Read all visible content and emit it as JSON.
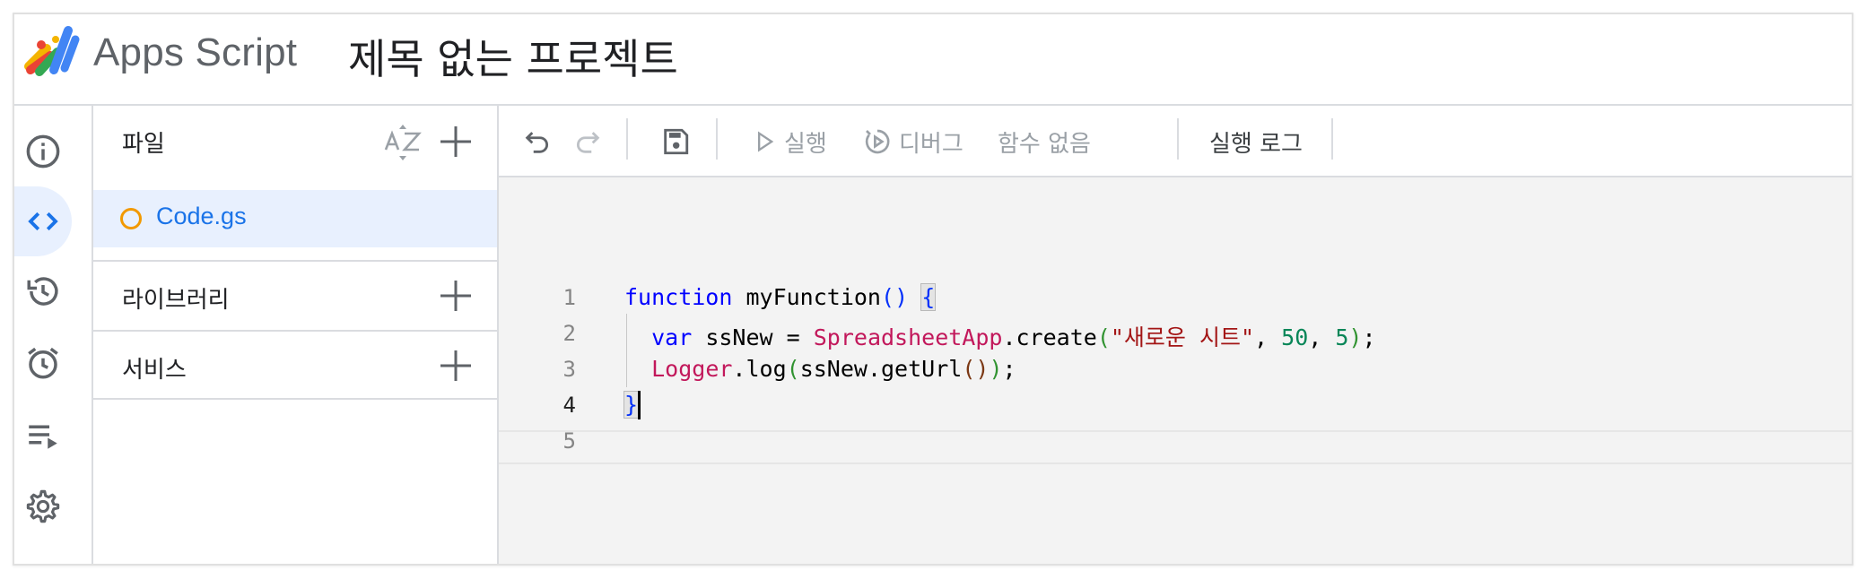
{
  "header": {
    "product_name": "Apps Script",
    "project_title": "제목 없는 프로젝트"
  },
  "rail": {
    "items": [
      {
        "icon": "info-icon"
      },
      {
        "icon": "code-brackets-icon",
        "active": true
      },
      {
        "icon": "history-icon"
      },
      {
        "icon": "alarm-clock-icon"
      },
      {
        "icon": "executions-list-icon"
      },
      {
        "icon": "gear-icon"
      }
    ]
  },
  "files_panel": {
    "title": "파일",
    "files": [
      {
        "name": "Code.gs",
        "selected": true
      }
    ],
    "sections": [
      {
        "label": "라이브러리"
      },
      {
        "label": "서비스"
      }
    ]
  },
  "toolbar": {
    "run_label": "실행",
    "debug_label": "디버그",
    "function_selector": "함수 없음",
    "execution_log_label": "실행 로그"
  },
  "editor": {
    "line_numbers": [
      "1",
      "2",
      "3",
      "4",
      "5"
    ],
    "current_line": 4,
    "code": {
      "l1_kw": "function",
      "l1_name": " myFunction",
      "l1_open": "(",
      "l1_close": ")",
      "l1_brace": "{",
      "l2_kw": "var",
      "l2_var": " ssNew = ",
      "l2_cls": "SpreadsheetApp",
      "l2_method": ".create",
      "l2_open": "(",
      "l2_str": "\"새로운 시트\"",
      "l2_sep1": ", ",
      "l2_num1": "50",
      "l2_sep2": ", ",
      "l2_num2": "5",
      "l2_close": ")",
      "l2_end": ";",
      "l3_cls": "Logger",
      "l3_method": ".log",
      "l3_open": "(",
      "l3_arg": "ssNew.getUrl",
      "l3_inner_open": "(",
      "l3_inner_close": ")",
      "l3_close": ")",
      "l3_end": ";",
      "l4_brace": "}"
    }
  },
  "colors": {
    "accent": "#1a73e8",
    "active_bg": "#e8f0fe",
    "file_dot": "#f29900",
    "keyword": "#0000ff",
    "class": "#c2185b",
    "string": "#a31515",
    "number": "#098658"
  }
}
